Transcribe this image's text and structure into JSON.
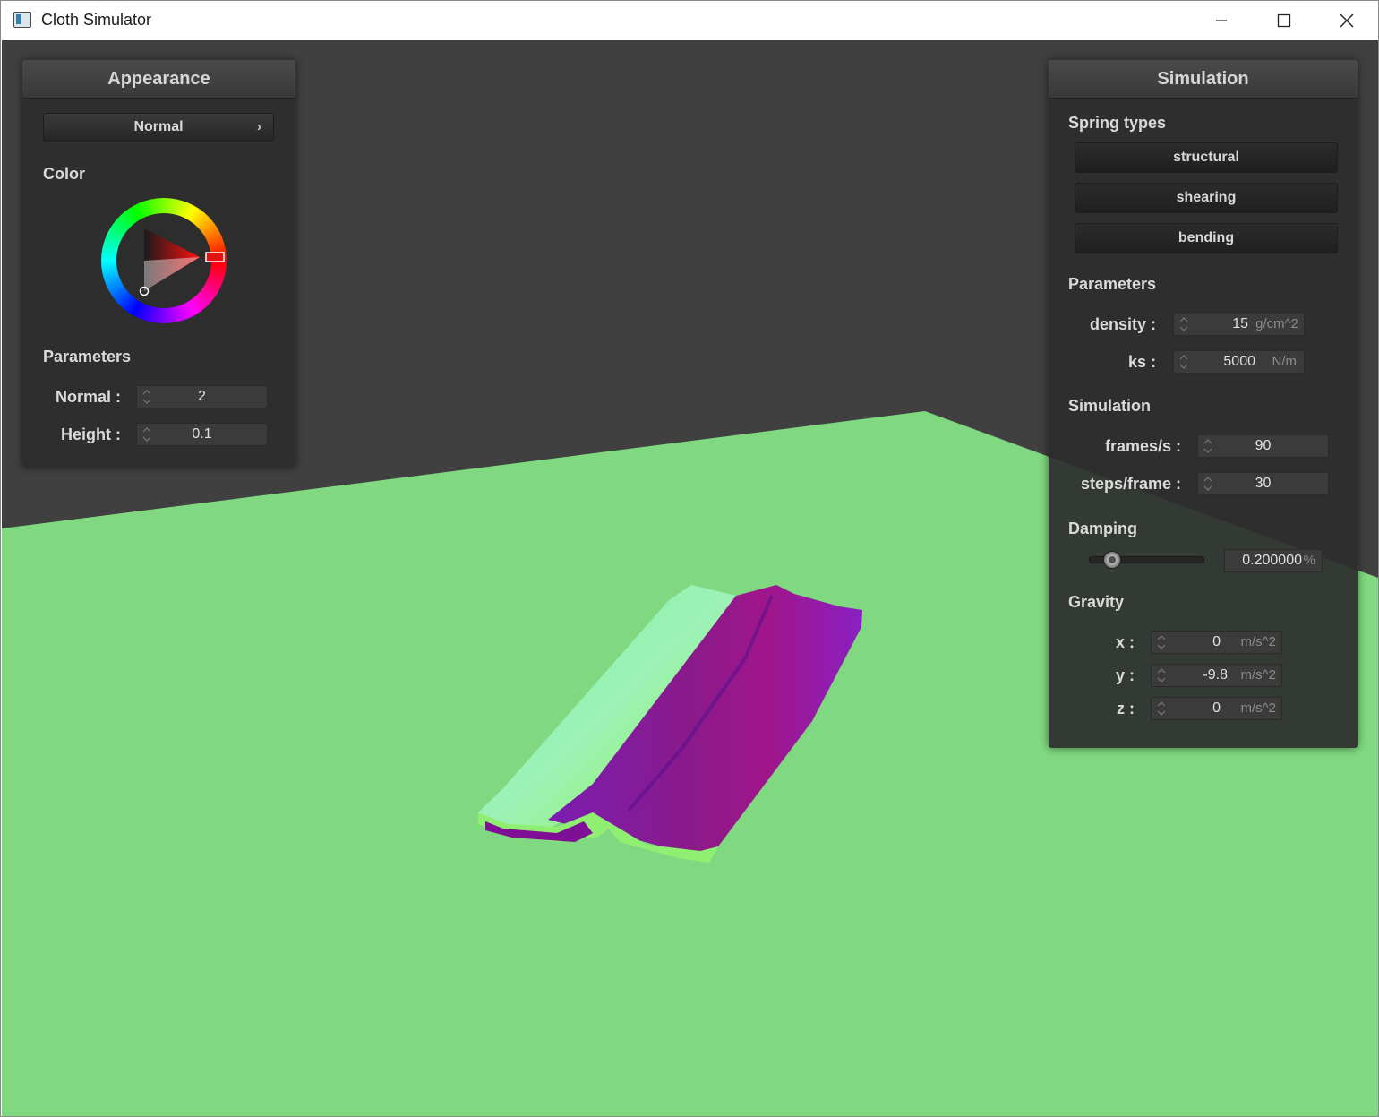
{
  "window": {
    "title": "Cloth Simulator",
    "controls": [
      "minimize-icon",
      "maximize-icon",
      "close-icon"
    ]
  },
  "scene": {
    "background_color": "#404040",
    "ground_color": "#80d980",
    "cloth_colors": [
      "#8a1aa8",
      "#7ff59a",
      "#93f542"
    ]
  },
  "appearance": {
    "header": "Appearance",
    "shader_select": "Normal",
    "color_label": "Color",
    "selected_color": "#ff0000",
    "parameters_label": "Parameters",
    "normal": {
      "label": "Normal :",
      "value": "2"
    },
    "height": {
      "label": "Height :",
      "value": "0.1"
    }
  },
  "simulation": {
    "header": "Simulation",
    "spring_types_label": "Spring types",
    "spring_buttons": [
      "structural",
      "shearing",
      "bending"
    ],
    "parameters_label": "Parameters",
    "density": {
      "label": "density :",
      "value": "15",
      "unit": "g/cm^2"
    },
    "ks": {
      "label": "ks :",
      "value": "5000",
      "unit": "N/m"
    },
    "simulation_label": "Simulation",
    "frames": {
      "label": "frames/s :",
      "value": "90"
    },
    "steps": {
      "label": "steps/frame :",
      "value": "30"
    },
    "damping_label": "Damping",
    "damping": {
      "value": "0.200000",
      "unit": "%",
      "slider_fraction": 0.2
    },
    "gravity_label": "Gravity",
    "gravity": [
      {
        "label": "x :",
        "value": "0",
        "unit": "m/s^2"
      },
      {
        "label": "y :",
        "value": "-9.8",
        "unit": "m/s^2"
      },
      {
        "label": "z :",
        "value": "0",
        "unit": "m/s^2"
      }
    ]
  }
}
